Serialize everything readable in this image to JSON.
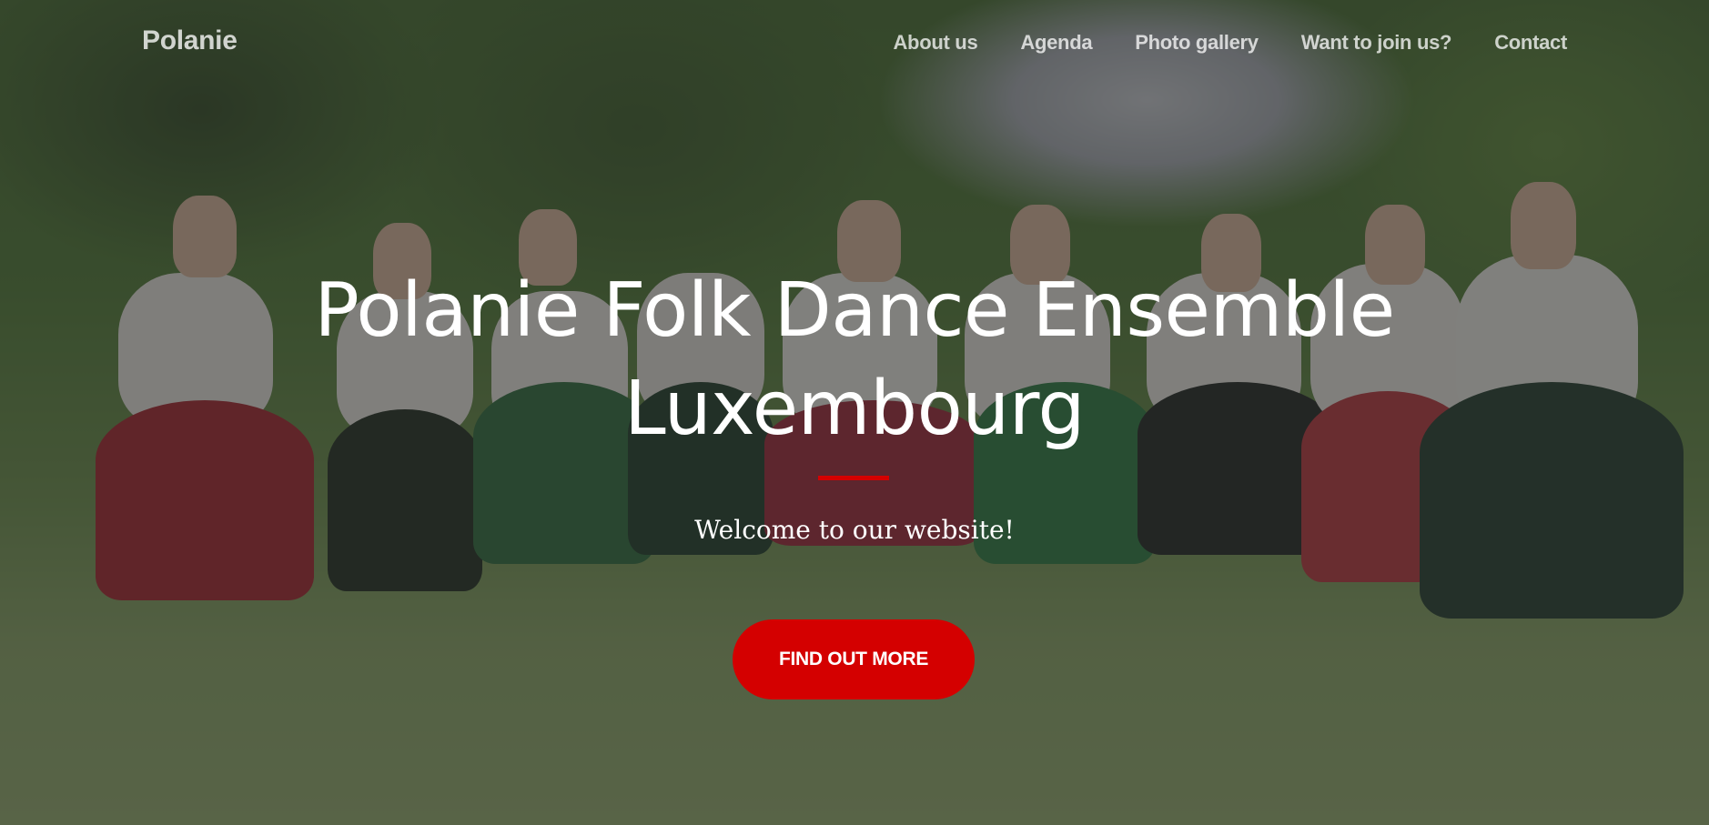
{
  "nav": {
    "brand": "Polanie",
    "links": [
      "About us",
      "Agenda",
      "Photo gallery",
      "Want to join us?",
      "Contact"
    ]
  },
  "hero": {
    "title_line1": "Polanie Folk Dance Ensemble",
    "title_line2": "Luxembourg",
    "tagline": "Welcome to our website!",
    "cta_label": "FIND OUT MORE"
  },
  "colors": {
    "accent": "#d40000",
    "text": "#ffffff",
    "overlay": "#282828"
  }
}
